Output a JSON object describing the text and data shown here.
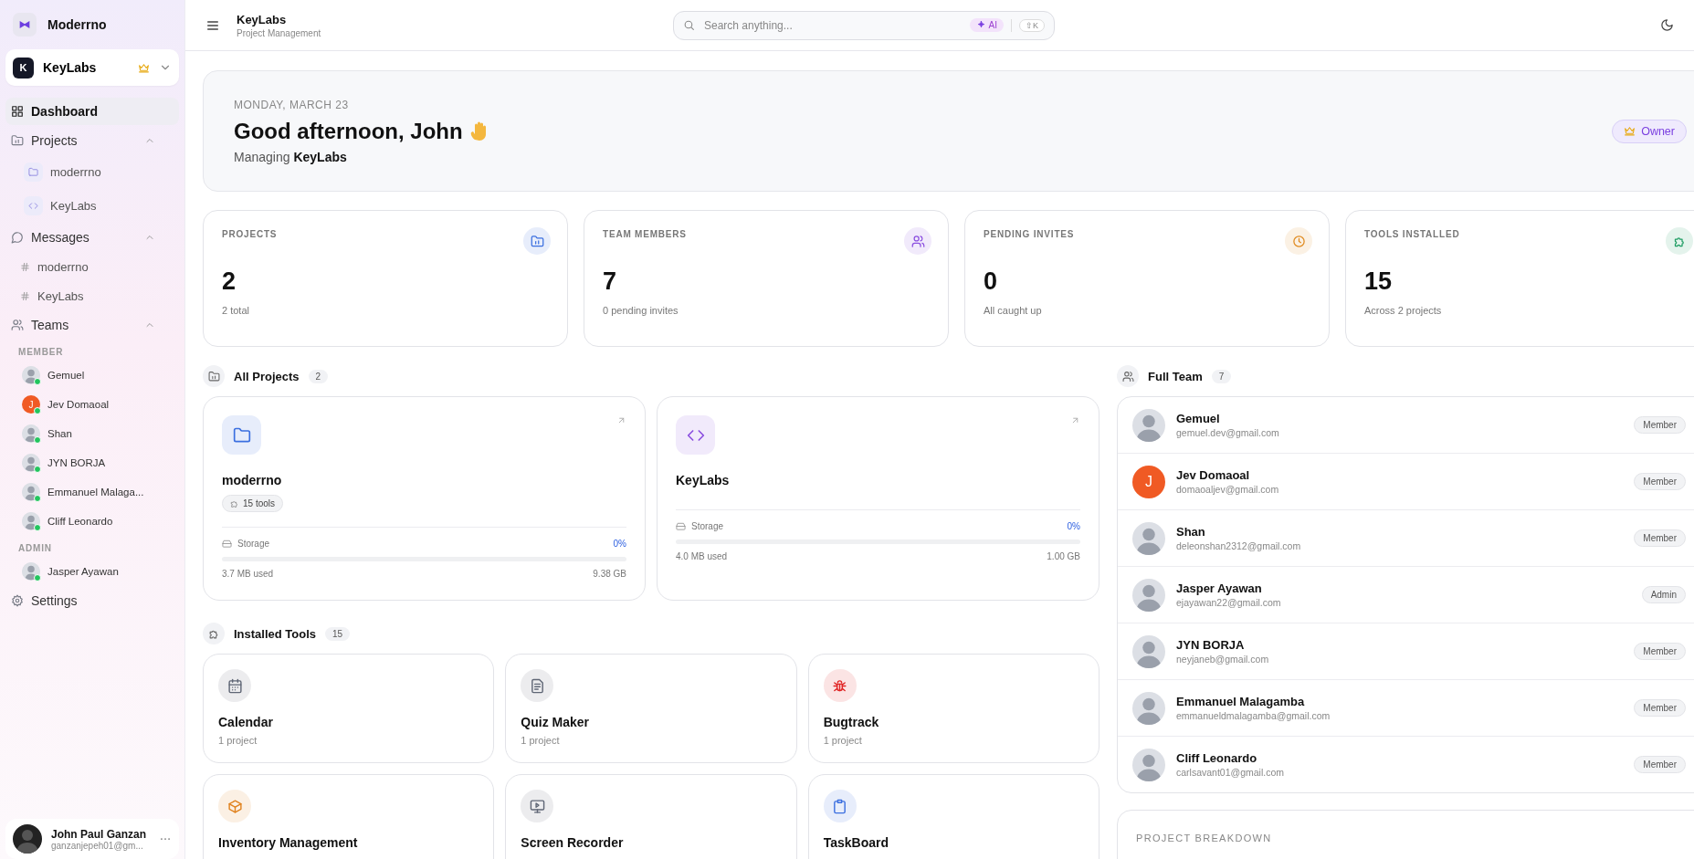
{
  "sidebar": {
    "brand": "Moderrno",
    "workspace": {
      "initial": "K",
      "name": "KeyLabs"
    },
    "nav": [
      {
        "kind": "link",
        "label": "Dashboard",
        "selected": true
      },
      {
        "kind": "section",
        "label": "Projects",
        "selected": false,
        "expanded": true,
        "children": [
          {
            "kind": "project",
            "label": "moderrno",
            "selected": false
          },
          {
            "kind": "project",
            "label": "KeyLabs",
            "selected": false
          }
        ]
      },
      {
        "kind": "section",
        "label": "Messages",
        "selected": false,
        "expanded": true,
        "children": [
          {
            "kind": "channel",
            "label": "moderrno",
            "selected": false
          },
          {
            "kind": "channel",
            "label": "KeyLabs",
            "selected": false
          }
        ]
      },
      {
        "kind": "section",
        "label": "Teams",
        "selected": false,
        "expanded": true,
        "groups": [
          {
            "heading": "MEMBER",
            "members": [
              {
                "name": "Gemuel",
                "online": true
              },
              {
                "name": "Jev Domaoal",
                "initial": "J",
                "online": true
              },
              {
                "name": "Shan",
                "online": true
              },
              {
                "name": "JYN BORJA",
                "online": true
              },
              {
                "name": "Emmanuel Malaga...",
                "online": true
              },
              {
                "name": "Cliff Leonardo",
                "online": true
              }
            ]
          },
          {
            "heading": "ADMIN",
            "members": [
              {
                "name": "Jasper Ayawan",
                "online": true
              }
            ]
          }
        ]
      },
      {
        "kind": "link",
        "label": "Settings",
        "selected": false
      }
    ],
    "user": {
      "name": "John Paul Ganzan",
      "email": "ganzanjepeh01@gm..."
    }
  },
  "header": {
    "title": "KeyLabs",
    "subtitle": "Project Management",
    "search": {
      "placeholder": "Search anything...",
      "ai": "AI",
      "shortcut": "⇧K"
    }
  },
  "welcome": {
    "date": "MONDAY, MARCH 23",
    "greeting": "Good afternoon, John",
    "managing": "Managing **KeyLabs**",
    "role": "Owner"
  },
  "stats": [
    {
      "label": "PROJECTS",
      "value": "2",
      "note": "2 total",
      "color": "#3b6fe0"
    },
    {
      "label": "TEAM MEMBERS",
      "value": "7",
      "note": "0 pending invites",
      "color": "#8b4fe0"
    },
    {
      "label": "PENDING INVITES",
      "value": "0",
      "note": "All caught up",
      "color": "#e08a1e"
    },
    {
      "label": "TOOLS INSTALLED",
      "value": "15",
      "note": "Across 2 projects",
      "color": "#1f9d63"
    }
  ],
  "projects": {
    "title": "All Projects",
    "count": "2",
    "items": [
      {
        "name": "moderrno",
        "color": "#3b6fe0",
        "tools": "15 tools",
        "storage_label": "Storage",
        "percent": "0%",
        "level": 0,
        "used": "3.7 MB used",
        "total": "9.38 GB"
      },
      {
        "name": "KeyLabs",
        "color": "#8b4fe0",
        "storage_label": "Storage",
        "percent": "0%",
        "level": 0,
        "used": "4.0 MB used",
        "total": "1.00 GB"
      }
    ]
  },
  "tools": {
    "title": "Installed Tools",
    "count": "15",
    "items": [
      {
        "name": "Calendar",
        "note": "1 project",
        "color": "#5f6675"
      },
      {
        "name": "Quiz Maker",
        "note": "1 project",
        "color": "#5f6675"
      },
      {
        "name": "Bugtrack",
        "note": "1 project",
        "color": "#e02424"
      },
      {
        "name": "Inventory Management",
        "color": "#e0821e"
      },
      {
        "name": "Screen Recorder",
        "color": "#5f6675"
      },
      {
        "name": "TaskBoard",
        "color": "#3b6fe0"
      }
    ]
  },
  "team": {
    "title": "Full Team",
    "count": "7",
    "members": [
      {
        "name": "Gemuel",
        "email": "gemuel.dev@gmail.com",
        "role": "Member"
      },
      {
        "name": "Jev Domaoal",
        "email": "domaoaljev@gmail.com",
        "role": "Member",
        "initial": "J"
      },
      {
        "name": "Shan",
        "email": "deleonshan2312@gmail.com",
        "role": "Member"
      },
      {
        "name": "Jasper Ayawan",
        "email": "ejayawan22@gmail.com",
        "role": "Admin"
      },
      {
        "name": "JYN BORJA",
        "email": "neyjaneb@gmail.com",
        "role": "Member"
      },
      {
        "name": "Emmanuel Malagamba",
        "email": "emmanueldmalagamba@gmail.com",
        "role": "Member"
      },
      {
        "name": "Cliff Leonardo",
        "email": "carlsavant01@gmail.com",
        "role": "Member"
      }
    ]
  },
  "breakdown": {
    "title": "PROJECT BREAKDOWN"
  }
}
